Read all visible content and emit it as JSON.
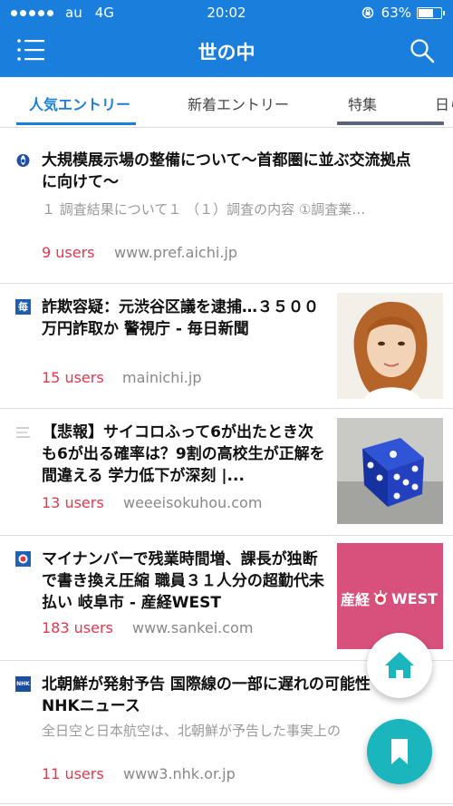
{
  "status_bar": {
    "carrier": "au",
    "network": "4G",
    "time": "20:02",
    "battery": "63%",
    "battery_level": 0.63
  },
  "header": {
    "title": "世の中"
  },
  "tabs": [
    {
      "label": "人気エントリー"
    },
    {
      "label": "新着エントリー"
    },
    {
      "label": "特集"
    },
    {
      "label": "日ら"
    }
  ],
  "entries": [
    {
      "title": "大規模展示場の整備について〜首都圏に並ぶ交流拠点に向けて〜",
      "snippet": "１ 調査結果について１ （１）調査の内容 ①調査業…",
      "users": "9 users",
      "domain": "www.pref.aichi.jp",
      "favicon": "aichi-prefecture-icon"
    },
    {
      "title": "詐欺容疑：元渋谷区議を逮捕…３５００万円詐取か 警視庁 - 毎日新聞",
      "users": "15 users",
      "domain": "mainichi.jp",
      "favicon": "mainichi-icon",
      "favicon_text": "毎"
    },
    {
      "title": "【悲報】サイコロふって6が出たとき次も6が出る確率は？9割の高校生が正解を間違える 学力低下が深刻 |...",
      "users": "13 users",
      "domain": "weeeisokuhou.com",
      "favicon": "blog-icon"
    },
    {
      "title": "マイナンバーで残業時間増、課長が独断で書き換え圧縮 職員３１人分の超勤代未払い 岐阜市 - 産経WEST",
      "users": "183 users",
      "domain": "www.sankei.com",
      "favicon": "sankei-icon",
      "thumb_text": "産経",
      "thumb_text2": "WEST"
    },
    {
      "title": "北朝鮮が発射予告 国際線の一部に遅れの可能性 NHKニュース",
      "snippet": "全日空と日本航空は、北朝鮮が予告した事実上の",
      "users": "11 users",
      "domain": "www3.nhk.or.jp",
      "favicon": "nhk-icon",
      "favicon_text": "NHK"
    }
  ],
  "colors": {
    "accent": "#1a7fdc",
    "users": "#e4364c",
    "fab": "#1bb5bd"
  }
}
